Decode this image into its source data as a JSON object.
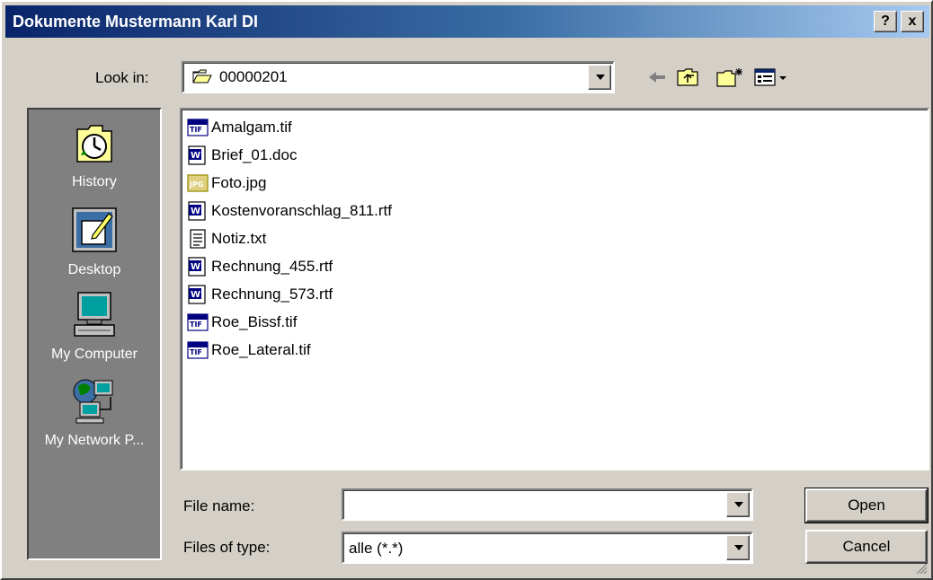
{
  "window": {
    "title": "Dokumente Mustermann Karl DI",
    "help_label": "?",
    "close_label": "x"
  },
  "lookin": {
    "label": "Look in:",
    "value": "00000201"
  },
  "places": [
    {
      "label": "History",
      "icon": "history-icon"
    },
    {
      "label": "Desktop",
      "icon": "desktop-icon"
    },
    {
      "label": "My Computer",
      "icon": "my-computer-icon"
    },
    {
      "label": "My Network P...",
      "icon": "network-icon"
    }
  ],
  "files": [
    {
      "name": "Amalgam.tif",
      "type": "tif"
    },
    {
      "name": "Brief_01.doc",
      "type": "word"
    },
    {
      "name": "Foto.jpg",
      "type": "jpg"
    },
    {
      "name": "Kostenvoranschlag_811.rtf",
      "type": "word"
    },
    {
      "name": "Notiz.txt",
      "type": "txt"
    },
    {
      "name": "Rechnung_455.rtf",
      "type": "word"
    },
    {
      "name": "Rechnung_573.rtf",
      "type": "word"
    },
    {
      "name": "Roe_Bissf.tif",
      "type": "tif"
    },
    {
      "name": "Roe_Lateral.tif",
      "type": "tif"
    }
  ],
  "filename": {
    "label": "File name:",
    "value": ""
  },
  "filetype": {
    "label": "Files of type:",
    "value": "alle (*.*)"
  },
  "buttons": {
    "open": "Open",
    "cancel": "Cancel"
  }
}
